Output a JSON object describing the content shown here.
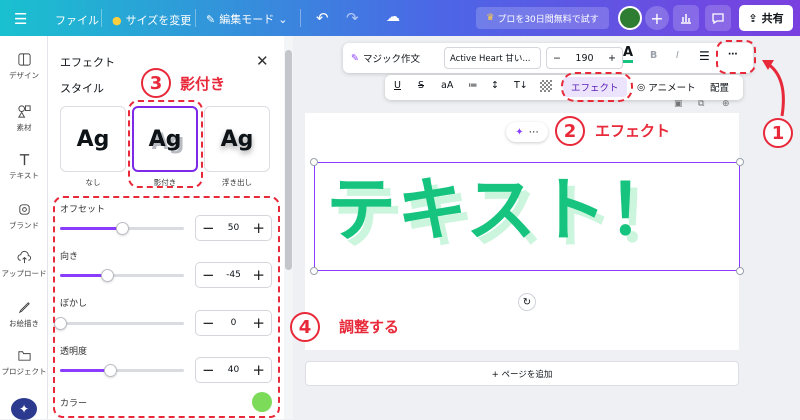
{
  "topbar": {
    "file": "ファイル",
    "resize": "サイズを変更",
    "edit_mode": "編集モード",
    "promo": "プロを30日間無料で試す",
    "share": "共有"
  },
  "rail": [
    {
      "label": "デザイン",
      "icon": "layout-icon"
    },
    {
      "label": "素材",
      "icon": "elements-icon"
    },
    {
      "label": "テキスト",
      "icon": "text-icon"
    },
    {
      "label": "ブランド",
      "icon": "brand-icon"
    },
    {
      "label": "アップロード",
      "icon": "upload-icon"
    },
    {
      "label": "お絵描き",
      "icon": "draw-icon"
    },
    {
      "label": "プロジェクト",
      "icon": "folder-icon"
    }
  ],
  "panel": {
    "title": "エフェクト",
    "style_heading": "スタイル",
    "styles": [
      {
        "sample": "Ag",
        "label": "なし"
      },
      {
        "sample": "Ag",
        "label": "影付き"
      },
      {
        "sample": "Ag",
        "label": "浮き出し"
      }
    ],
    "sliders": [
      {
        "label": "オフセット",
        "value": "50",
        "level": 50
      },
      {
        "label": "向き",
        "value": "-45",
        "level": -45
      },
      {
        "label": "ぼかし",
        "value": "0",
        "level": 0
      },
      {
        "label": "透明度",
        "value": "40",
        "level": 40
      }
    ],
    "color_label": "カラー",
    "color_value": "#7cdb58"
  },
  "toolbar": {
    "magic": "マジック作文",
    "font": "Active Heart 甘い...",
    "size": "190",
    "effects": "エフェクト",
    "animate": "アニメート",
    "position": "配置"
  },
  "canvas": {
    "text": "テキスト！",
    "text_color": "#16c47f",
    "shadow_color": "#ccf5de",
    "add_page": "+ ページを追加"
  },
  "annotations": {
    "n1": "1",
    "n2": "2",
    "n3": "3",
    "n4": "4",
    "a2": "エフェクト",
    "a3": "影付き",
    "a4": "調整する"
  },
  "colors": {
    "accent": "#8b3dff",
    "annotation": "#e8293a"
  }
}
